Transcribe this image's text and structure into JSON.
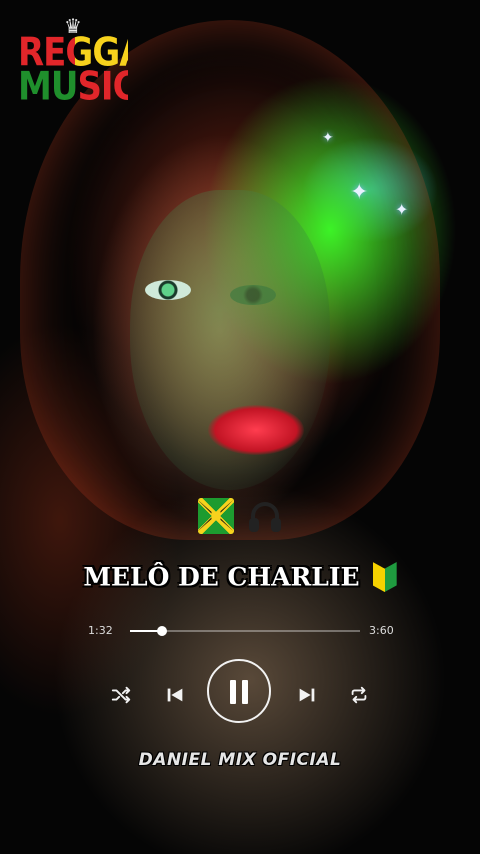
{
  "logo": {
    "line1": "REGGAE",
    "line2": "MUSIC",
    "emblem_icon": "lion-icon"
  },
  "emojis": [
    "jamaica-flag-icon",
    "headphones-icon"
  ],
  "track": {
    "title": "MELÔ DE CHARLIE",
    "title_icon": "beginner-symbol-icon",
    "current_time": "1:32",
    "total_time": "3:60",
    "progress": 0.14
  },
  "controls": {
    "shuffle_icon": "shuffle-icon",
    "prev_icon": "previous-track-icon",
    "play_state_icon": "pause-icon",
    "next_icon": "next-track-icon",
    "repeat_icon": "repeat-icon"
  },
  "channel": {
    "name": "DANIEL MIX OFICIAL"
  },
  "colors": {
    "reggae_red": "#e1262a",
    "reggae_yellow": "#f7d21d",
    "reggae_green": "#1f8f2c",
    "accent_neon_green": "#3cff28"
  }
}
